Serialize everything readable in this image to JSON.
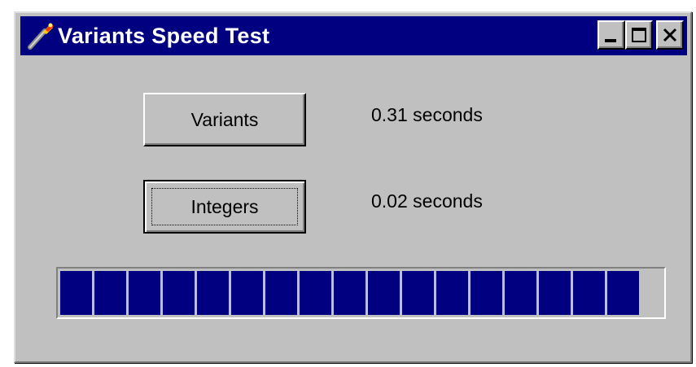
{
  "window": {
    "title": "Variants Speed Test",
    "icon": "torch-icon",
    "controls": {
      "minimize_icon": "minimize-icon",
      "maximize_icon": "maximize-icon",
      "close_label": "✕"
    }
  },
  "buttons": {
    "variants_label": "Variants",
    "integers_label": "Integers"
  },
  "results": {
    "variants_time": "0.31 seconds",
    "integers_time": "0.02 seconds"
  },
  "progress": {
    "value_percent": 100,
    "segments_visible": 17,
    "fill_color": "#000080"
  },
  "colors": {
    "titlebar": "#000080",
    "face": "#c0c0c0"
  }
}
